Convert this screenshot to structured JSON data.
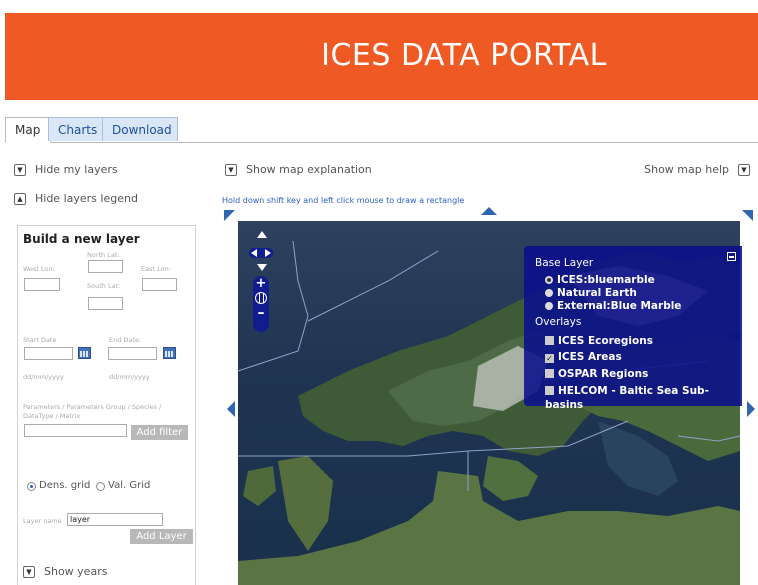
{
  "banner": {
    "title": "ICES DATA PORTAL",
    "color": "#ef5a24"
  },
  "tabs": [
    {
      "label": "Map",
      "active": true
    },
    {
      "label": "Charts",
      "active": false
    },
    {
      "label": "Download",
      "active": false
    }
  ],
  "left_toggles": {
    "hide_layers": "Hide my layers",
    "hide_legend": "Hide layers legend"
  },
  "map_explanation": "Show map explanation",
  "map_help": "Show map help",
  "hint": "Hold down shift key and left click mouse to draw a rectangle",
  "build_layer": {
    "title": "Build a new layer",
    "north_lat": "North Lat:",
    "west_lon": "West Lon:",
    "east_lon": "East Lon:",
    "south_lat": "South Lat:",
    "start_date": "Start Date",
    "end_date": "End Date:",
    "date_format_start": "dd/mm/yyyy",
    "date_format_end": "dd/mm/yyyy",
    "params_label": "Parameters / Parameters Group / Species / DataType / Matrix",
    "add_filter": "Add filter",
    "grid_options": [
      {
        "label": "Dens. grid",
        "selected": true
      },
      {
        "label": "Val. Grid",
        "selected": false
      }
    ],
    "layer_name_label": "Layer name",
    "layer_name_value": "layer",
    "add_layer": "Add Layer"
  },
  "show_years": "Show years",
  "layer_switcher": {
    "base_title": "Base Layer",
    "base_layers": [
      {
        "label": "ICES:bluemarble",
        "selected": true
      },
      {
        "label": "Natural Earth",
        "selected": false
      },
      {
        "label": "External:Blue Marble",
        "selected": false
      }
    ],
    "overlays_title": "Overlays",
    "overlays": [
      {
        "label": "ICES Ecoregions",
        "checked": false
      },
      {
        "label": "ICES Areas",
        "checked": true
      },
      {
        "label": "OSPAR Regions",
        "checked": false
      },
      {
        "label": "HELCOM - Baltic Sea Sub-basins",
        "checked": false
      }
    ]
  },
  "icons": [
    "toggle-expand-icon",
    "toggle-collapse-icon",
    "calendar-icon",
    "pan-arrows-icon",
    "zoom-in-icon",
    "globe-icon",
    "zoom-out-icon",
    "minimize-icon"
  ],
  "colors": {
    "tab_link": "#1d4f9a",
    "switcher_bg": "#0a0f8c",
    "hint": "#2a5fbf"
  }
}
